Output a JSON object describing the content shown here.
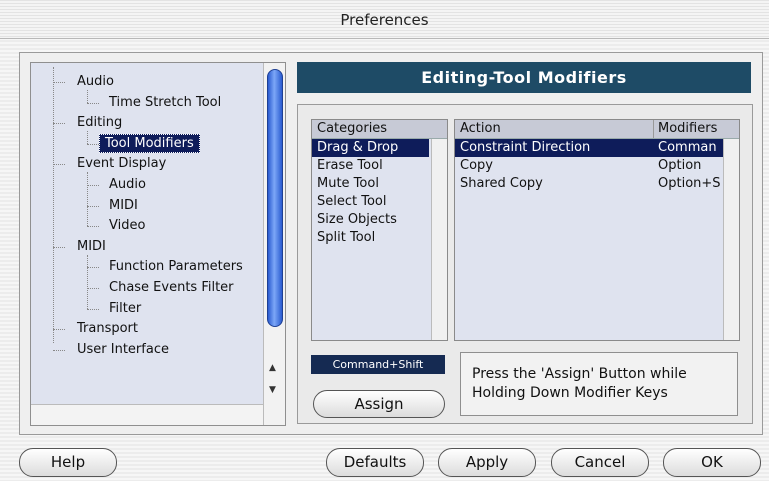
{
  "window": {
    "title": "Preferences"
  },
  "tree": {
    "items": [
      {
        "label": "Audio",
        "level": 0
      },
      {
        "label": "Time Stretch Tool",
        "level": 1
      },
      {
        "label": "Editing",
        "level": 0
      },
      {
        "label": "Tool Modifiers",
        "level": 1,
        "selected": true
      },
      {
        "label": "Event Display",
        "level": 0
      },
      {
        "label": "Audio",
        "level": 1
      },
      {
        "label": "MIDI",
        "level": 1
      },
      {
        "label": "Video",
        "level": 1
      },
      {
        "label": "MIDI",
        "level": 0
      },
      {
        "label": "Function Parameters",
        "level": 1
      },
      {
        "label": "Chase Events Filter",
        "level": 1
      },
      {
        "label": "Filter",
        "level": 1
      },
      {
        "label": "Transport",
        "level": 0
      },
      {
        "label": "User Interface",
        "level": 0
      }
    ]
  },
  "panel": {
    "title": "Editing-Tool Modifiers",
    "categories": {
      "header": "Categories",
      "items": [
        "Drag & Drop",
        "Erase Tool",
        "Mute Tool",
        "Select Tool",
        "Size Objects",
        "Split Tool"
      ],
      "selected_index": 0
    },
    "actions": {
      "headers": [
        "Action",
        "Modifiers"
      ],
      "rows": [
        {
          "action": "Constraint Direction",
          "modifiers": "Comman",
          "selected": true
        },
        {
          "action": "Copy",
          "modifiers": "Option"
        },
        {
          "action": "Shared Copy",
          "modifiers": "Option+S"
        }
      ]
    },
    "current_keys": "Command+Shift",
    "assign_label": "Assign",
    "hint_line1": "Press the 'Assign' Button while",
    "hint_line2": "Holding Down Modifier Keys"
  },
  "buttons": {
    "help": "Help",
    "defaults": "Defaults",
    "apply": "Apply",
    "cancel": "Cancel",
    "ok": "OK"
  }
}
